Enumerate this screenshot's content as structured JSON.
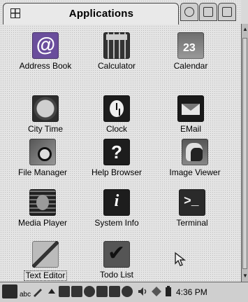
{
  "header": {
    "active_tab": "Applications",
    "tab_icon": "grid-icon",
    "other_tabs": [
      {
        "name": "tab-games",
        "icon": "games-icon"
      },
      {
        "name": "tab-settings",
        "icon": "settings-icon"
      },
      {
        "name": "tab-documents",
        "icon": "documents-icon"
      }
    ]
  },
  "apps": [
    {
      "label": "Address Book",
      "icon": "address-book-icon"
    },
    {
      "label": "Calculator",
      "icon": "calculator-icon"
    },
    {
      "label": "Calendar",
      "icon": "calendar-icon"
    },
    {
      "label": "City Time",
      "icon": "city-time-icon"
    },
    {
      "label": "Clock",
      "icon": "clock-icon"
    },
    {
      "label": "EMail",
      "icon": "email-icon"
    },
    {
      "label": "File Manager",
      "icon": "file-manager-icon"
    },
    {
      "label": "Help Browser",
      "icon": "help-icon"
    },
    {
      "label": "Image Viewer",
      "icon": "image-viewer-icon"
    },
    {
      "label": "Media Player",
      "icon": "media-player-icon"
    },
    {
      "label": "System Info",
      "icon": "info-icon"
    },
    {
      "label": "Terminal",
      "icon": "terminal-icon"
    },
    {
      "label": "Text Editor",
      "icon": "text-editor-icon"
    },
    {
      "label": "Todo List",
      "icon": "todo-icon"
    }
  ],
  "taskbar": {
    "input_mode": "abc",
    "time": "4:36 PM"
  }
}
